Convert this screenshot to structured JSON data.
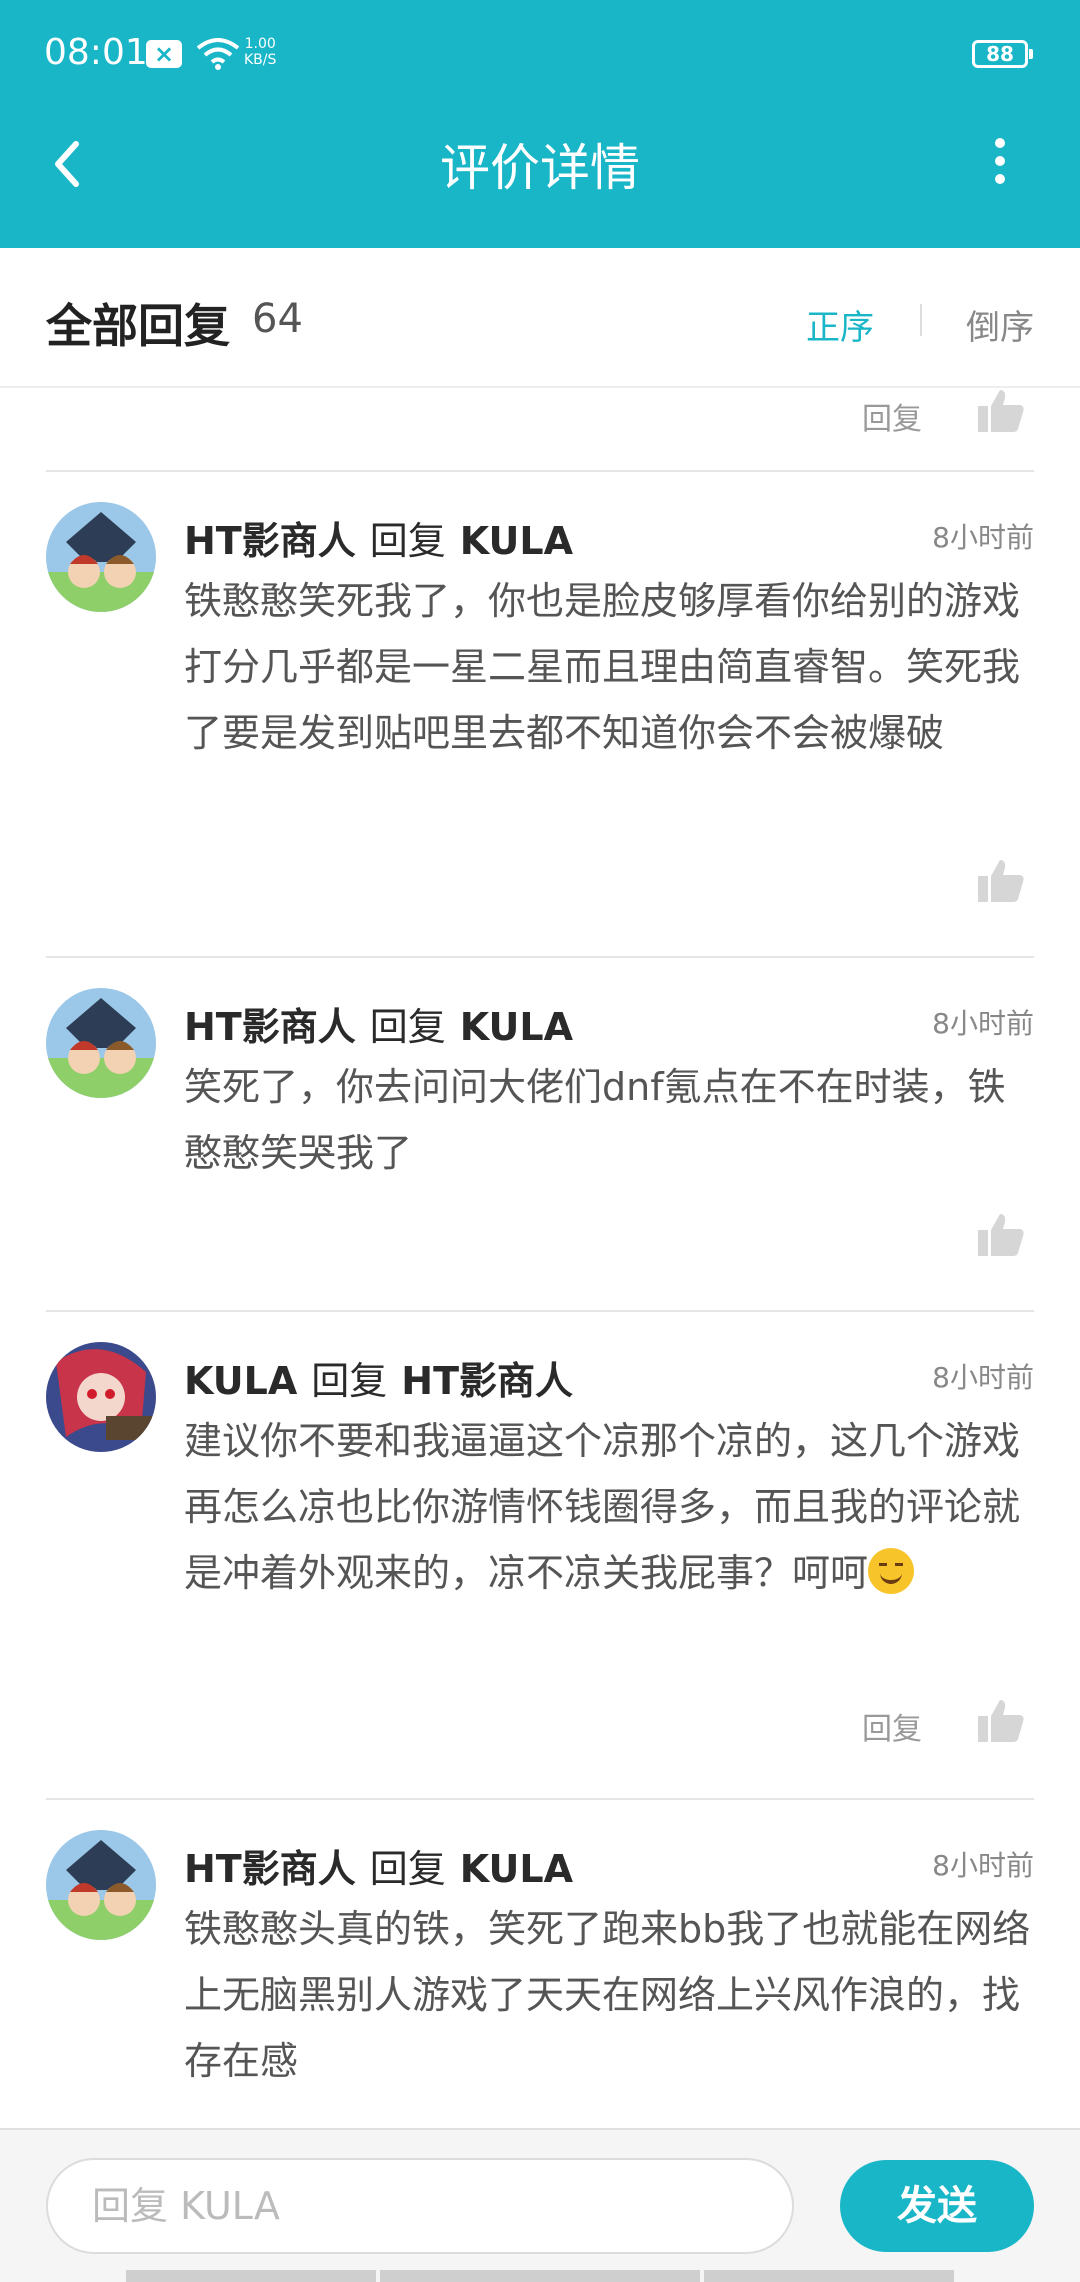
{
  "status_bar": {
    "time": "08:01",
    "net_speed_value": "1.00",
    "net_speed_unit": "KB/S",
    "battery": "88"
  },
  "header": {
    "title": "评价详情"
  },
  "sort_bar": {
    "label": "全部回复",
    "count": "64",
    "asc_label": "正序",
    "desc_label": "倒序"
  },
  "top_reply_label": "回复",
  "comments": [
    {
      "author": "HT影商人",
      "reply_word": "回复",
      "target": "KULA",
      "time": "8小时前",
      "text": "铁憨憨笑死我了，你也是脸皮够厚看你给别的游戏打分几乎都是一星二星而且理由简直睿智。笑死我了要是发到贴吧里去都不知道你会不会被爆破"
    },
    {
      "author": "HT影商人",
      "reply_word": "回复",
      "target": "KULA",
      "time": "8小时前",
      "text": "笑死了，你去问问大佬们dnf氪点在不在时装，铁憨憨笑哭我了"
    },
    {
      "author": "KULA",
      "reply_word": "回复",
      "target": "HT影商人",
      "time": "8小时前",
      "text": "建议你不要和我逼逼这个凉那个凉的，这几个游戏再怎么凉也比你游情怀钱圈得多，而且我的评论就是冲着外观来的，凉不凉关我屁事？呵呵",
      "reply_label": "回复"
    },
    {
      "author": "HT影商人",
      "reply_word": "回复",
      "target": "KULA",
      "time": "8小时前",
      "text": "铁憨憨头真的铁，笑死了跑来bb我了也就能在网络上无脑黑别人游戏了天天在网络上兴风作浪的，找存在感"
    }
  ],
  "bottom_bar": {
    "placeholder": "回复 KULA",
    "send_label": "发送"
  },
  "colors": {
    "accent": "#19b6c8"
  }
}
